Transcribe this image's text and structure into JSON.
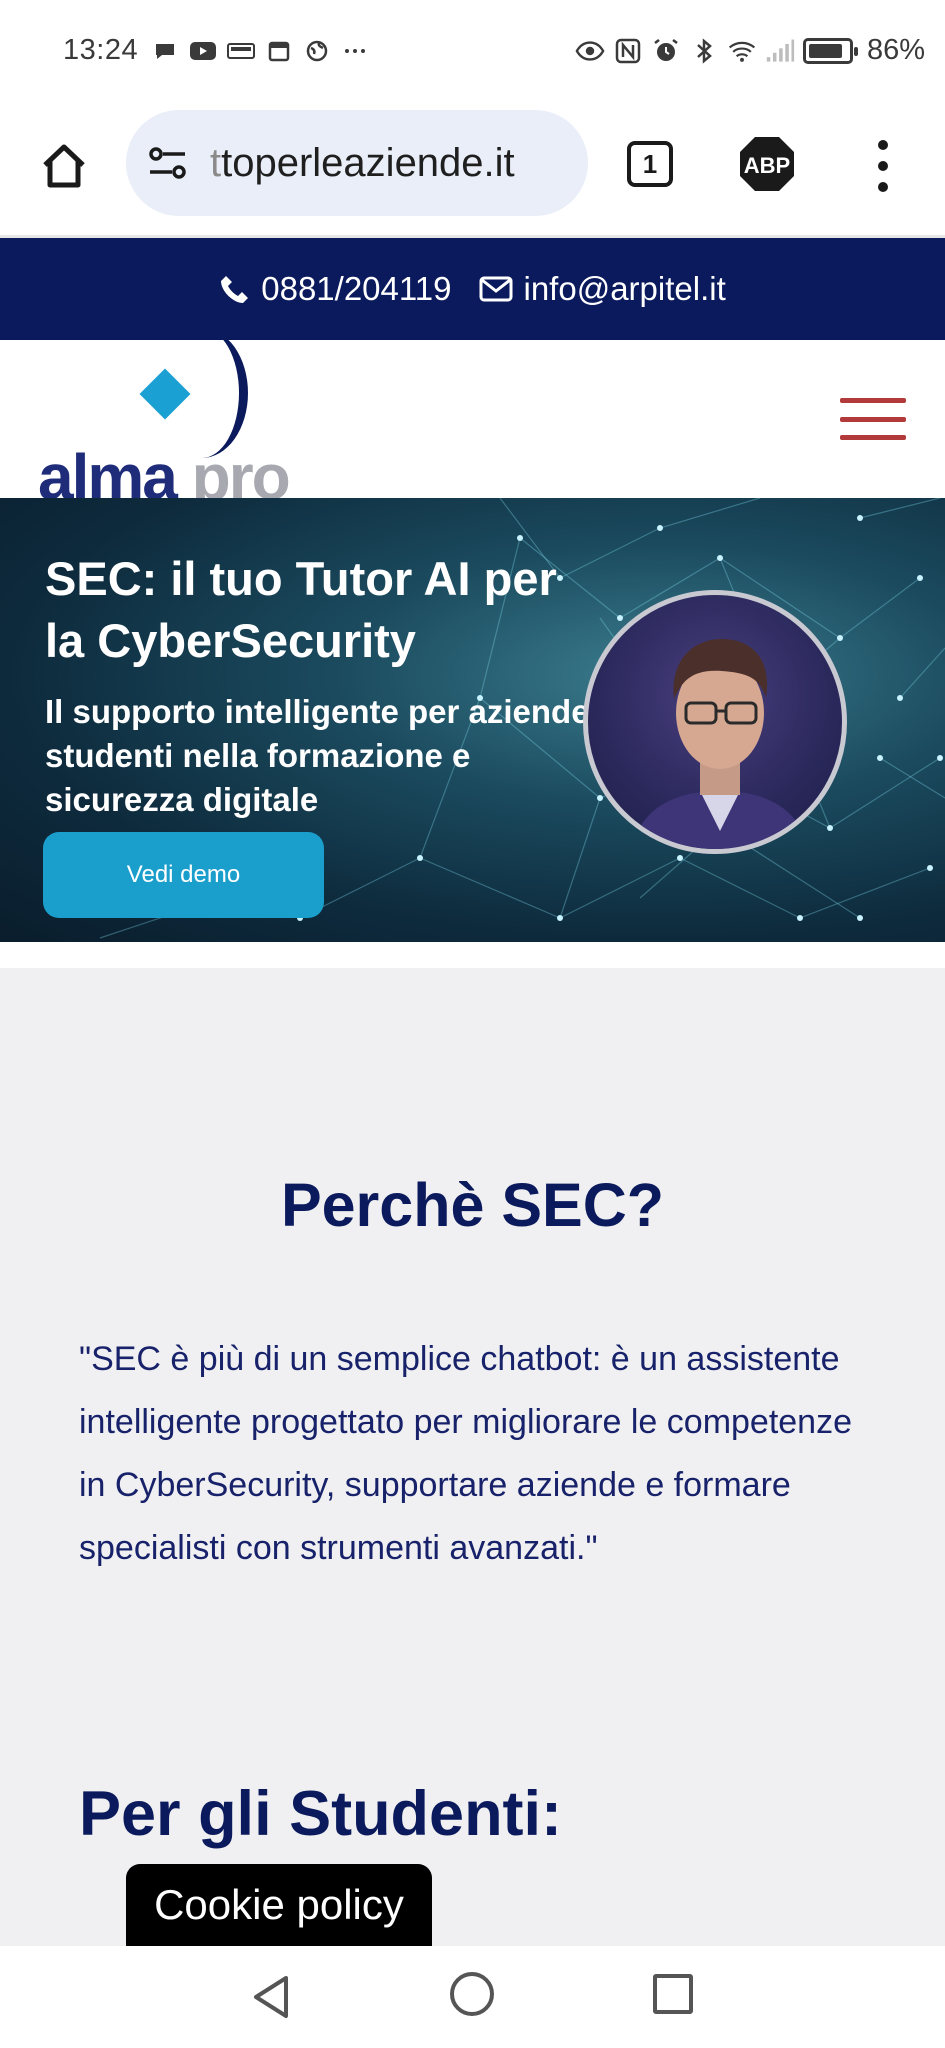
{
  "status_bar": {
    "time": "13:24",
    "battery": "86%",
    "battery_level": 0.86,
    "left_icons": [
      "chat-bubble-icon",
      "youtube-icon",
      "sport-icon",
      "calendar-icon",
      "globe-icon",
      "more-dots-icon"
    ],
    "right_icons": [
      "eye-icon",
      "nfc-icon",
      "alarm-icon",
      "bluetooth-icon",
      "wifi-icon",
      "signal-icon",
      "battery-icon"
    ]
  },
  "browser": {
    "url": "ttoperleaziende.it",
    "url_faded_prefix": "t",
    "url_rest": "toperleaziende.it",
    "tab_count": "1",
    "abp_label": "ABP"
  },
  "contact": {
    "phone": "0881/204119",
    "email": "info@arpitel.it"
  },
  "logo": {
    "primary": "alma",
    "secondary": "pro"
  },
  "hero": {
    "title": "SEC: il tuo Tutor AI per la CyberSecurity",
    "subtitle": "Il supporto intelligente per aziende e studenti nella formazione e sicurezza digitale",
    "button": "Vedi demo"
  },
  "main": {
    "heading": "Perchè SEC?",
    "quote": "\"SEC è più di un semplice chatbot: è un assistente intelligente progettato per migliorare le competenze in CyberSecurity, supportare aziende e formare specialisti con strumenti avanzati.\"",
    "section_heading": "Per gli Studenti:"
  },
  "cookie": {
    "label": "Cookie policy"
  },
  "colors": {
    "navy": "#0b1a5c",
    "accent_blue": "#1a9fcc",
    "hamburger_red": "#b23a3a",
    "content_bg": "#f0f0f2"
  }
}
